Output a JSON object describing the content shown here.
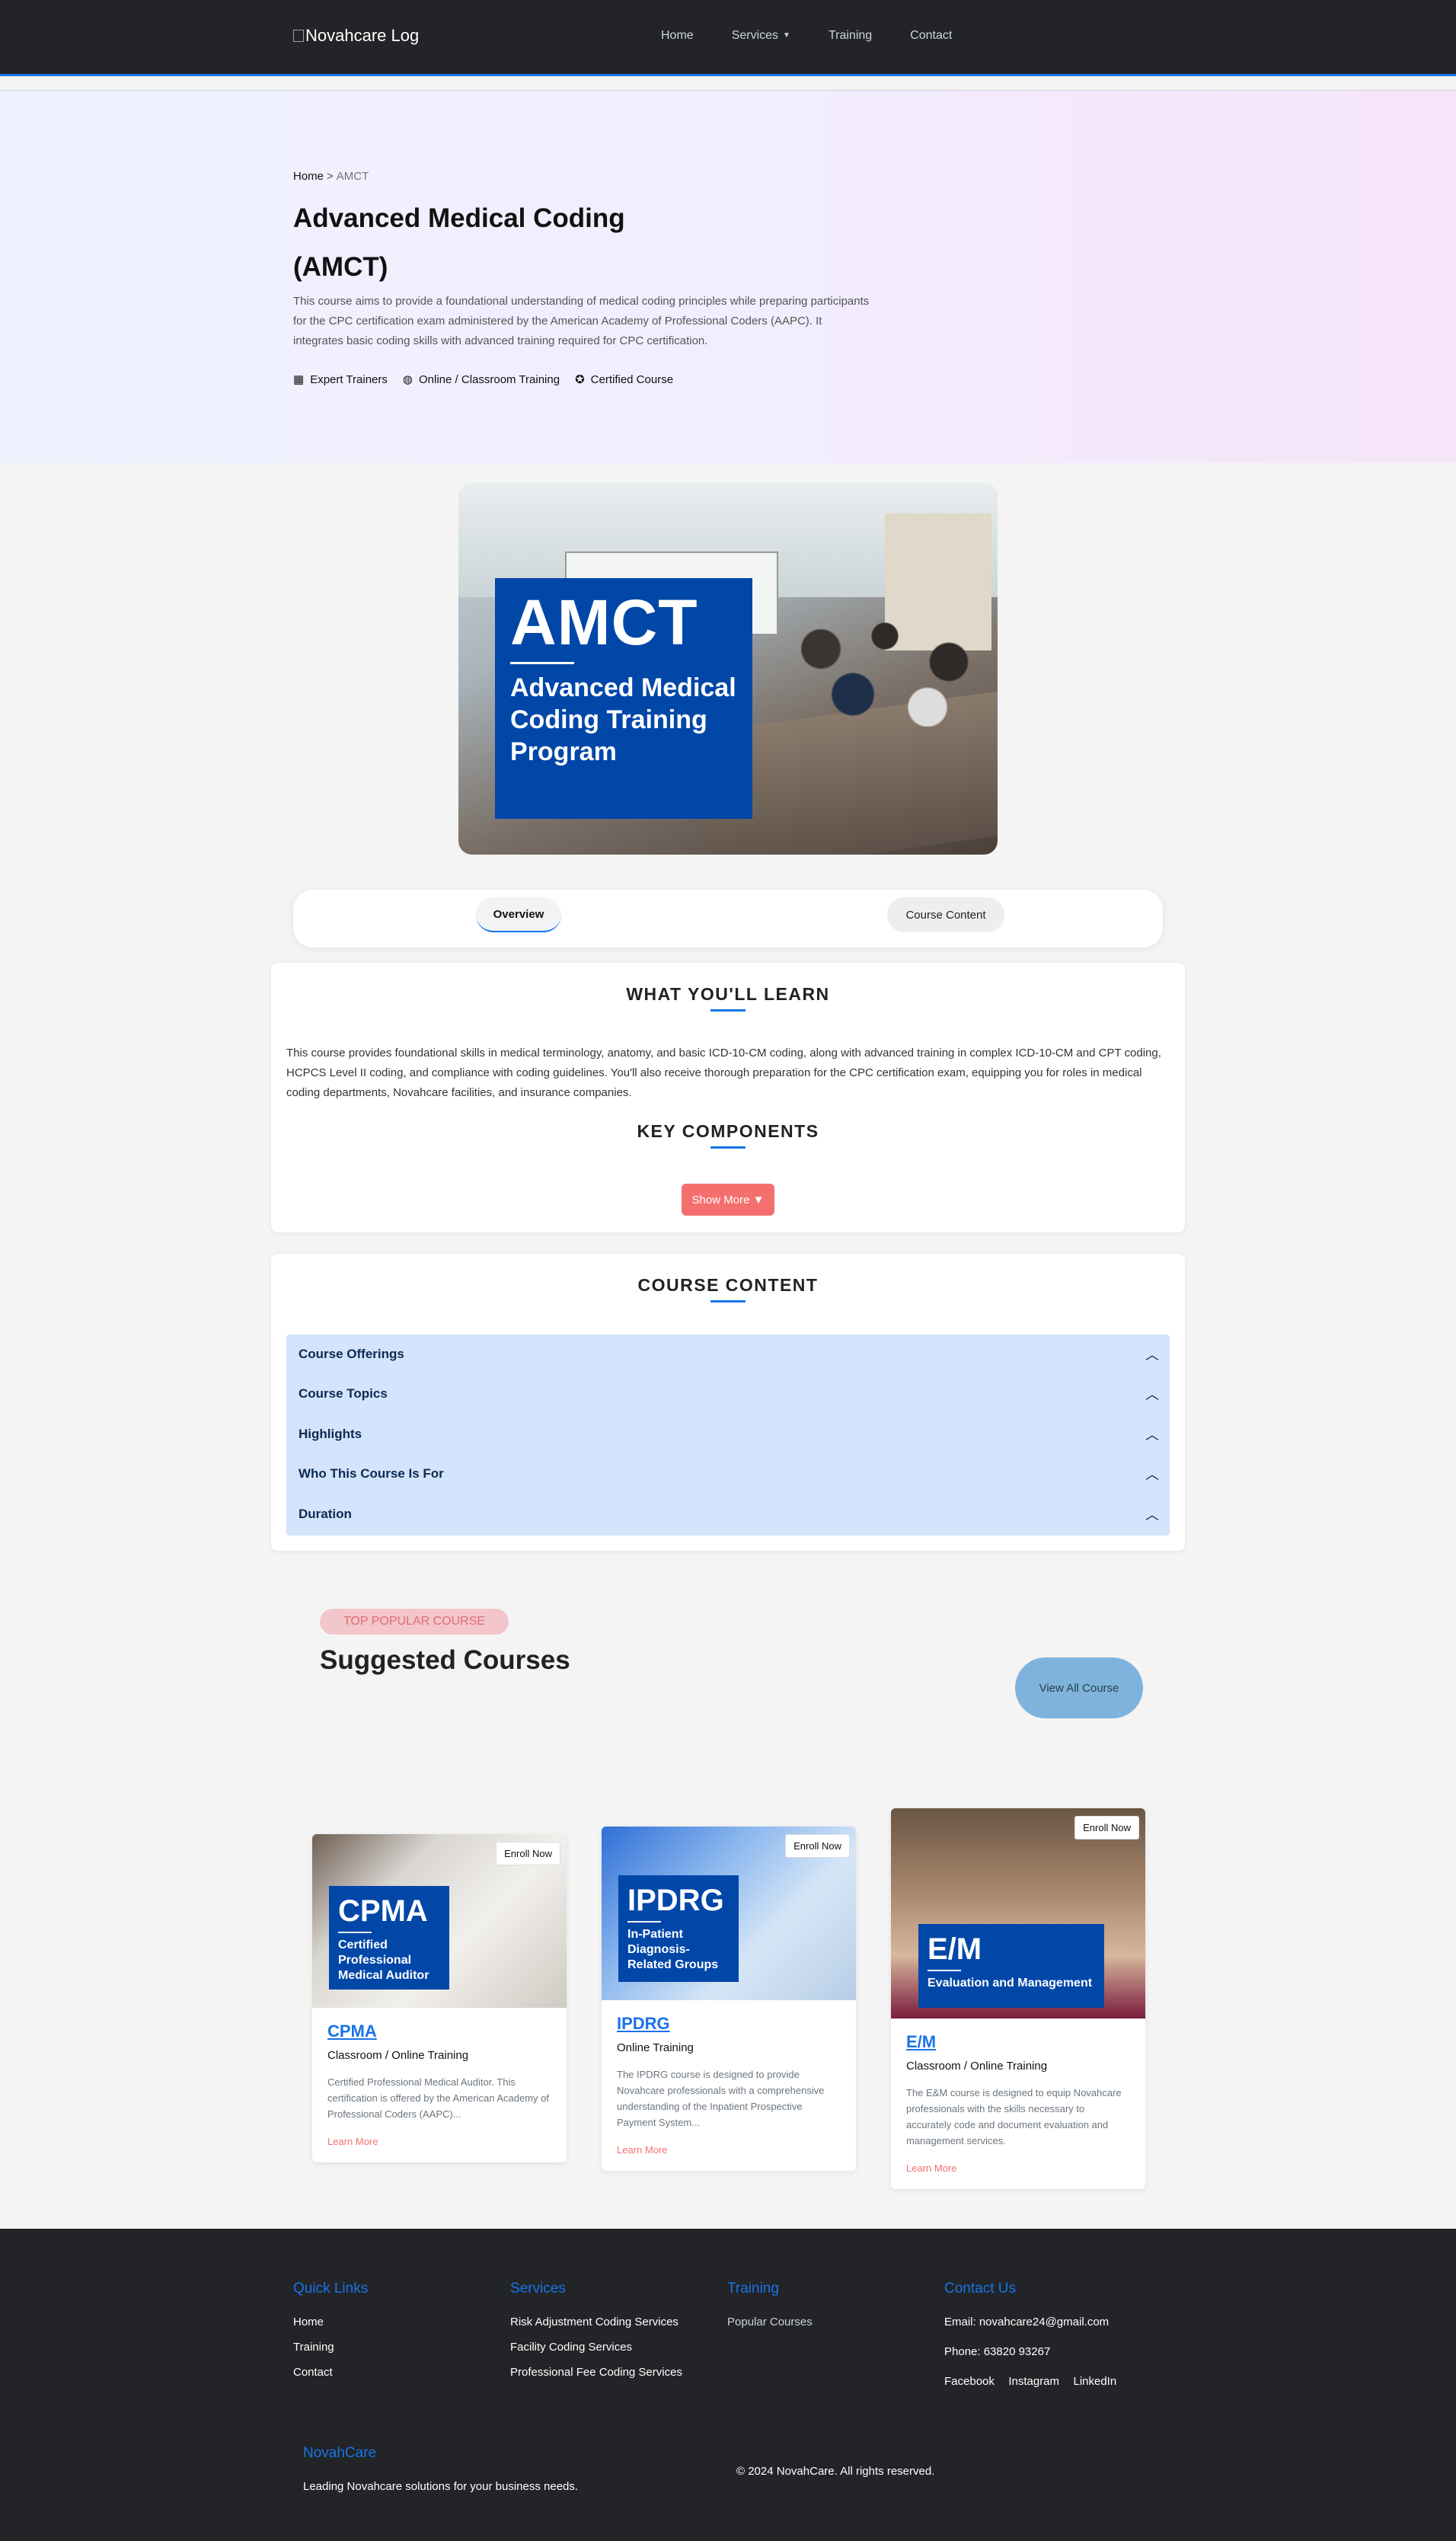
{
  "nav": {
    "logo_alt": "Novahcare Log",
    "links": [
      "Home",
      "Services",
      "Training",
      "Contact"
    ]
  },
  "hero": {
    "breadcrumb_home": "Home",
    "breadcrumb_current": "AMCT",
    "title": "Advanced Medical Coding (AMCT)",
    "description": "This course aims to provide a foundational understanding of medical coding principles while preparing participants for the CPC certification exam administered by the American Academy of Professional Coders (AAPC). It integrates basic coding skills with advanced training required for CPC certification.",
    "features": [
      "Expert Trainers",
      "Online / Classroom Training",
      "Certified Course"
    ]
  },
  "banner": {
    "acronym": "AMCT",
    "subtitle": "Advanced Medical Coding Training Program"
  },
  "tabs": [
    "Overview",
    "Course Content"
  ],
  "learn": {
    "title": "WHAT YOU'LL LEARN",
    "text": "This course provides foundational skills in medical terminology, anatomy, and basic ICD-10-CM coding, along with advanced training in complex ICD-10-CM and CPT coding, HCPCS Level II coding, and compliance with coding guidelines. You'll also receive thorough preparation for the CPC certification exam, equipping you for roles in medical coding departments, Novahcare facilities, and insurance companies.",
    "components_title": "KEY COMPONENTS",
    "show_more": "Show More ▼"
  },
  "course_content": {
    "title": "COURSE CONTENT",
    "items": [
      "Course Offerings",
      "Course Topics",
      "Highlights",
      "Who This Course Is For",
      "Duration"
    ]
  },
  "suggested": {
    "badge": "TOP POPULAR COURSE",
    "title": "Suggested Courses",
    "view_all": "View All Course",
    "enroll_label": "Enroll Now",
    "learn_more": "Learn More",
    "courses": [
      {
        "img_title": "CPMA",
        "img_sub": "Certified Professional Medical Auditor",
        "name": "CPMA",
        "mode": "Classroom / Online Training",
        "desc": "Certified Professional Medical Auditor. This certification is offered by the American Academy of Professional Coders (AAPC)..."
      },
      {
        "img_title": "IPDRG",
        "img_sub": "In-Patient Diagnosis-Related Groups",
        "name": "IPDRG",
        "mode": "Online Training",
        "desc": "The IPDRG course is designed to provide Novahcare professionals with a comprehensive understanding of the Inpatient Prospective Payment System..."
      },
      {
        "img_title": "E/M",
        "img_sub": "Evaluation and Management",
        "name": "E/M",
        "mode": "Classroom / Online Training",
        "desc": "The E&M course is designed to equip Novahcare professionals with the skills necessary to accurately code and document evaluation and management services."
      }
    ]
  },
  "footer": {
    "quick_links_title": "Quick Links",
    "quick_links": [
      "Home",
      "Training",
      "Contact"
    ],
    "services_title": "Services",
    "services": [
      "Risk Adjustment Coding Services",
      "Facility Coding Services",
      "Professional Fee Coding Services"
    ],
    "training_title": "Training",
    "training": [
      "Popular Courses"
    ],
    "contact_title": "Contact Us",
    "email": "Email: novahcare24@gmail.com",
    "phone": "Phone: 63820 93267",
    "social": [
      "Facebook",
      "Instagram",
      "LinkedIn"
    ],
    "brand": "NovahCare",
    "tagline": "Leading Novahcare solutions for your business needs.",
    "copyright": "© 2024 NovahCare. All rights reserved."
  }
}
